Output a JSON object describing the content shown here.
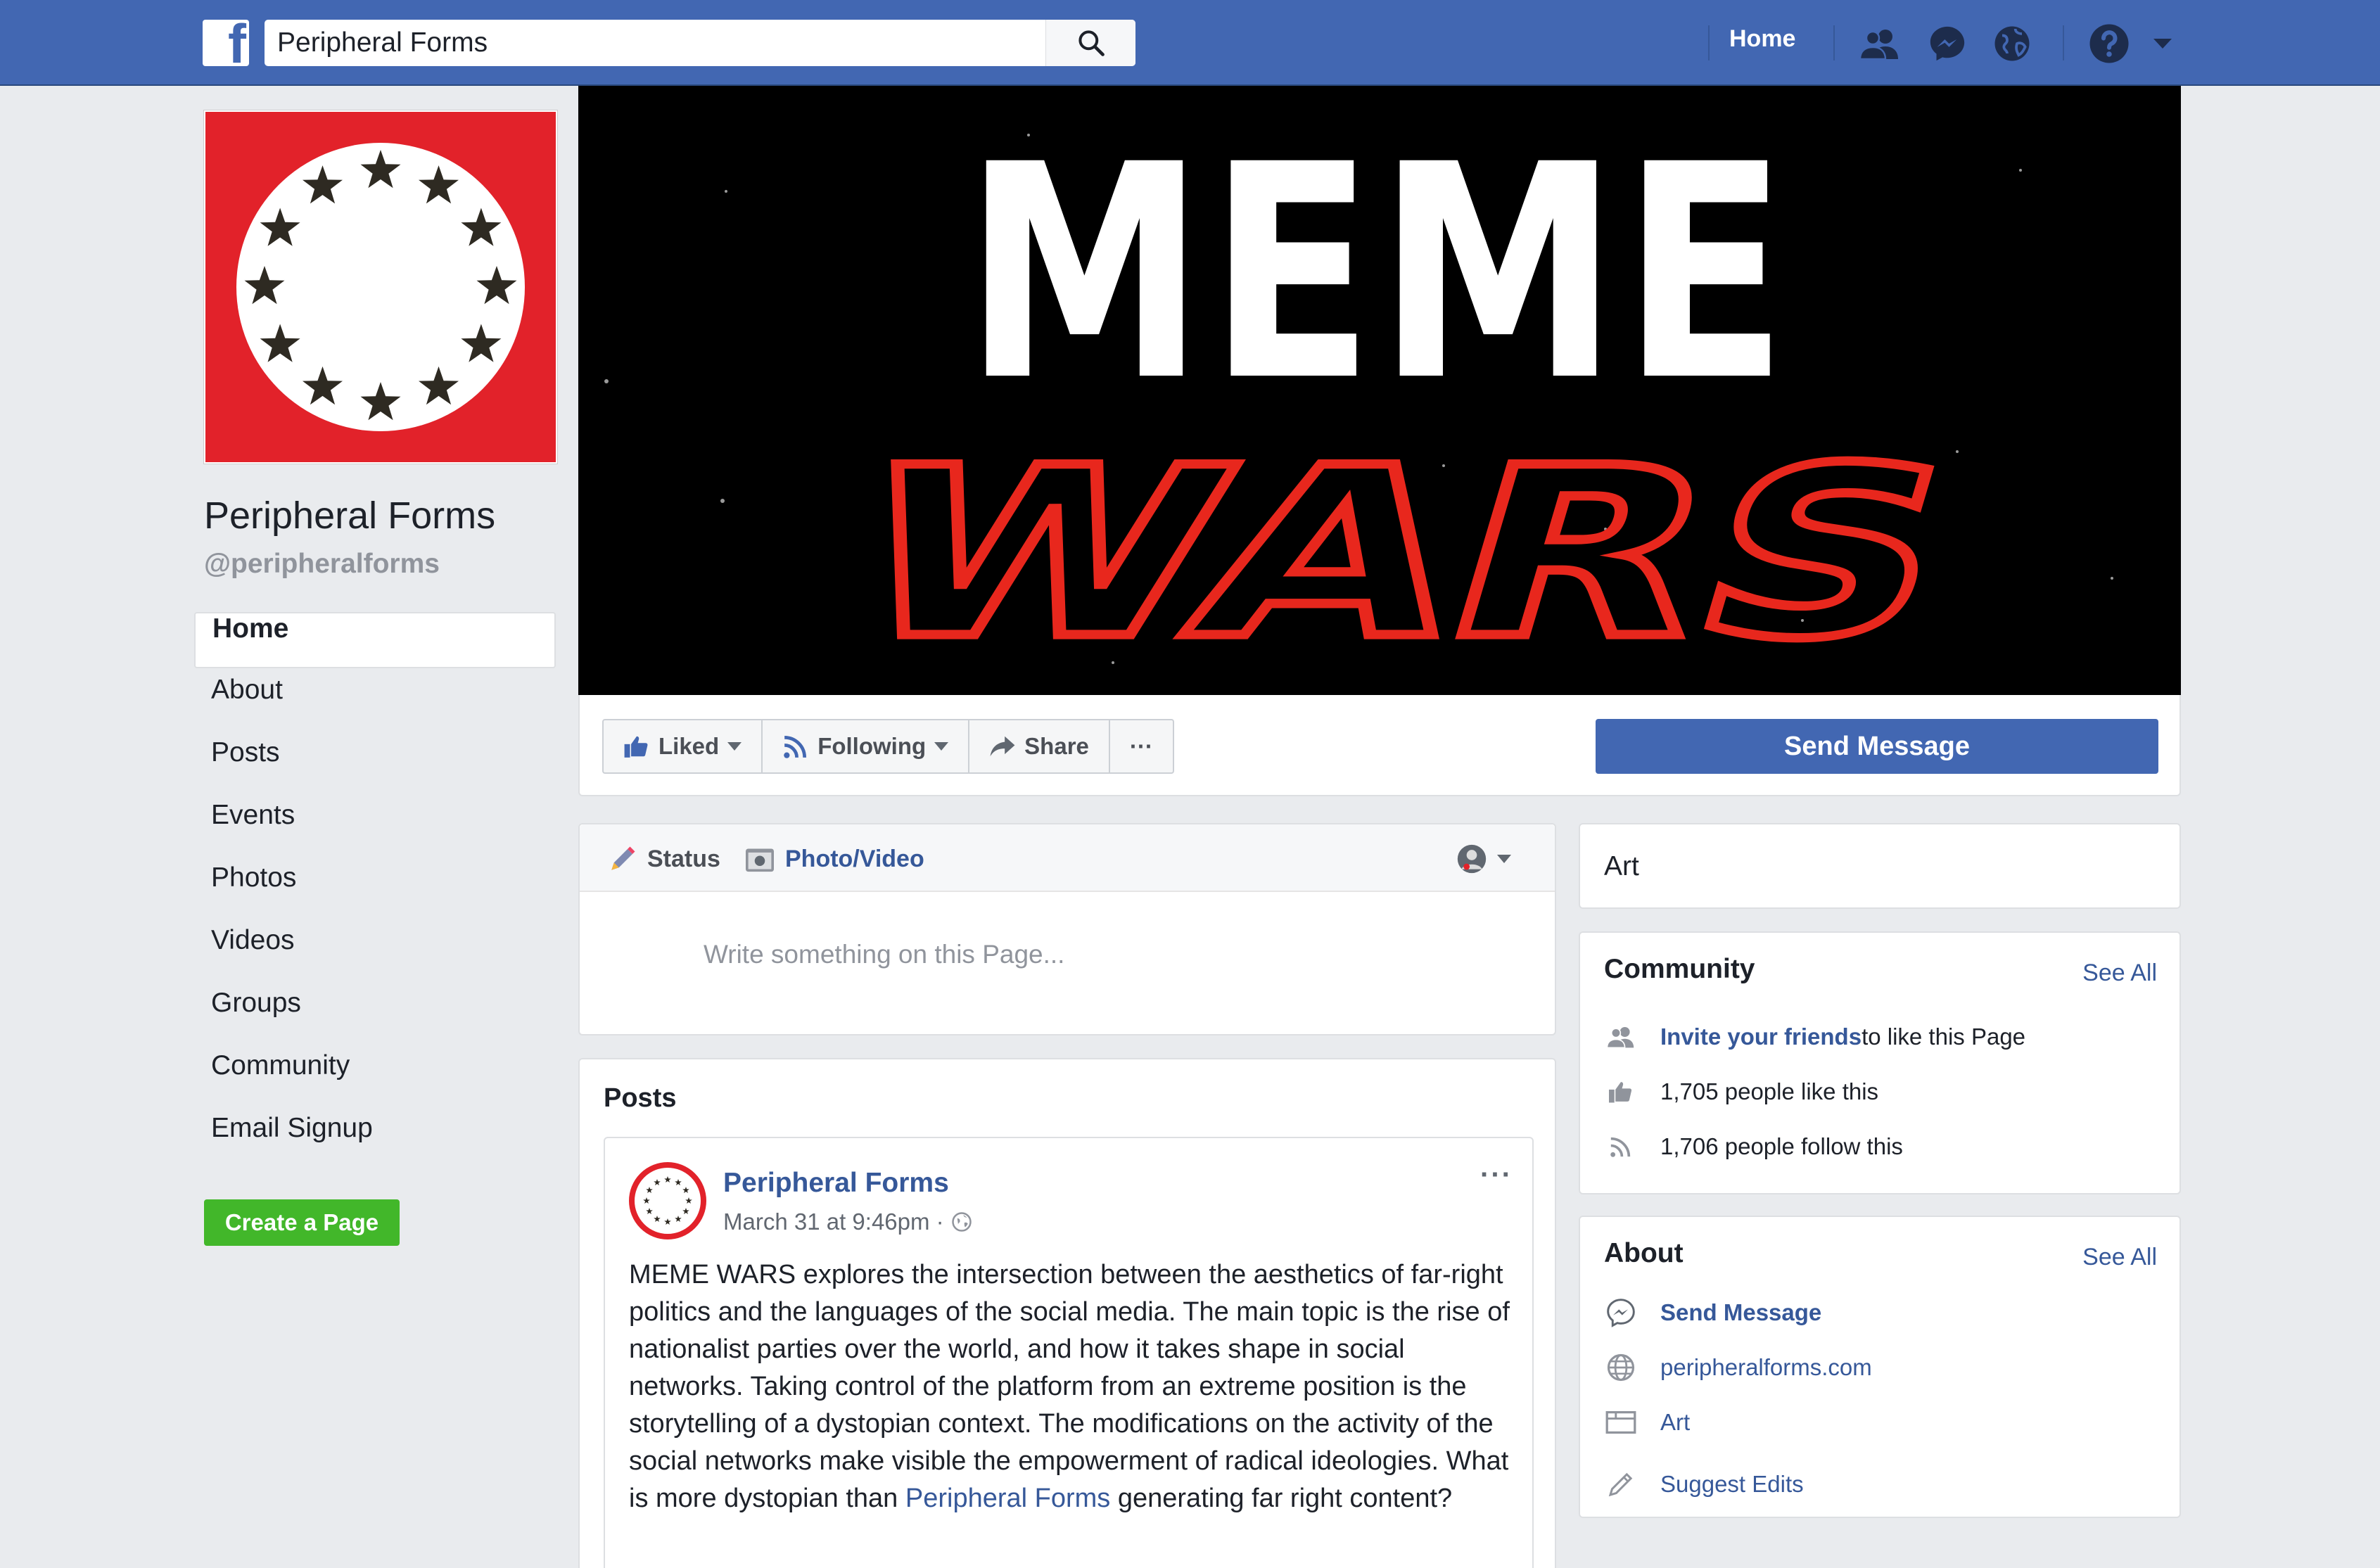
{
  "topbar": {
    "logo_letter": "f",
    "search_value": "Peripheral Forms",
    "home_label": "Home"
  },
  "page": {
    "name": "Peripheral Forms",
    "handle": "@peripheralforms",
    "brand_red": "#e2222a"
  },
  "leftnav": {
    "items": [
      {
        "label": "Home",
        "active": true
      },
      {
        "label": "About"
      },
      {
        "label": "Posts"
      },
      {
        "label": "Events"
      },
      {
        "label": "Photos"
      },
      {
        "label": "Videos"
      },
      {
        "label": "Groups"
      },
      {
        "label": "Community"
      },
      {
        "label": "Email Signup"
      }
    ],
    "create_page": "Create a Page"
  },
  "cover": {
    "line1": "MEME",
    "line2": "WARS"
  },
  "actions": {
    "liked": "Liked",
    "following": "Following",
    "share": "Share",
    "more": "···",
    "send_message": "Send Message"
  },
  "composer": {
    "status": "Status",
    "photo_video": "Photo/Video",
    "placeholder": "Write something on this Page..."
  },
  "posts": {
    "title": "Posts",
    "post": {
      "author": "Peripheral Forms",
      "date": "March 31 at 9:46pm ·",
      "more": "···",
      "body": "MEME WARS explores the intersection between the aesthetics of far-right politics and the languages of the social media. The main topic is the rise of nationalist parties over the world, and how it takes shape in social networks. Taking control of the platform from an extreme position is the storytelling of a dystopian context. The modifications on the activity of the social networks make visible the empowerment of radical ideologies. What is more dystopian than ",
      "body_link": "Peripheral Forms",
      "body_end": " generating far right content?"
    }
  },
  "right": {
    "category": "Art",
    "community": {
      "title": "Community",
      "see_all": "See All",
      "invite_link": "Invite your friends",
      "invite_rest": " to like this Page",
      "likes": "1,705 people like this",
      "follows": "1,706 people follow this"
    },
    "about": {
      "title": "About",
      "see_all": "See All",
      "send_message": "Send Message",
      "website": "peripheralforms.com",
      "category": "Art",
      "suggest_edits": "Suggest Edits"
    }
  }
}
